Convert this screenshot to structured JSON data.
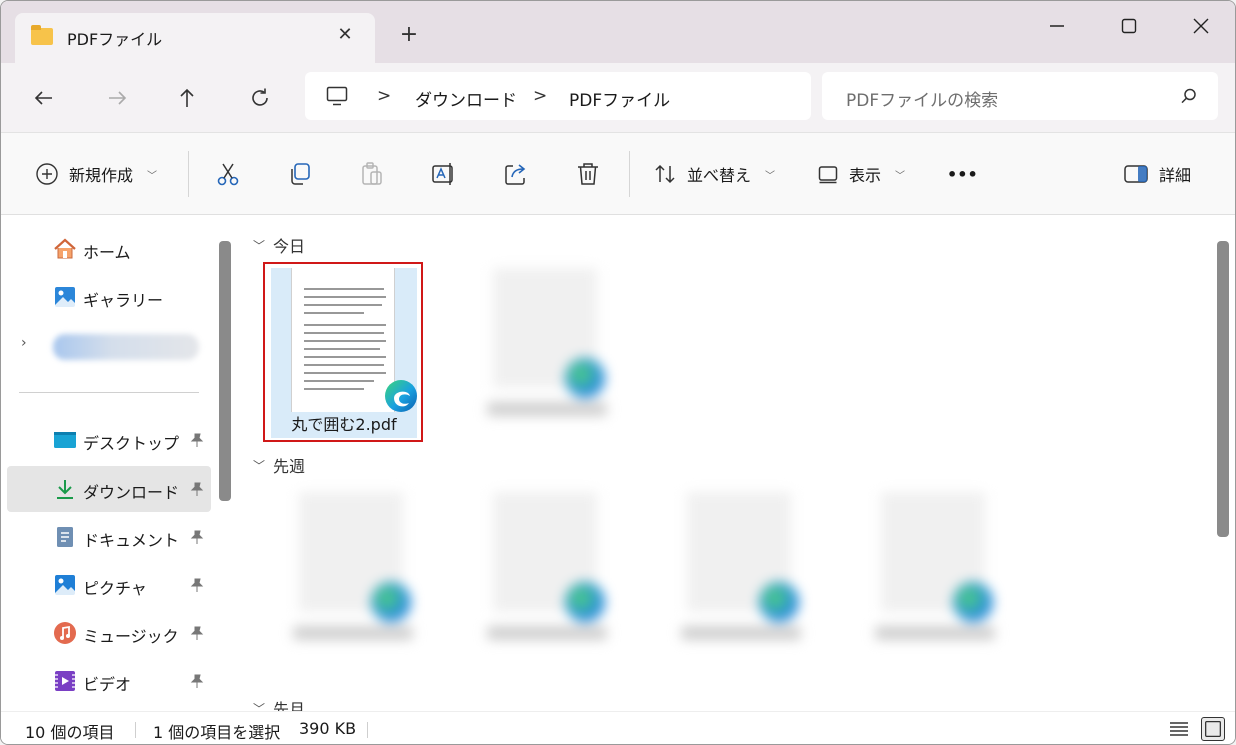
{
  "window": {
    "tab_title": "PDFファイル",
    "new_tab_symbol": "+"
  },
  "address": {
    "crumbs": [
      "ダウンロード",
      "PDFファイル"
    ],
    "separator": ">"
  },
  "search": {
    "placeholder": "PDFファイルの検索"
  },
  "toolbar": {
    "new_label": "新規作成",
    "sort_label": "並べ替え",
    "view_label": "表示",
    "more_label": "•••",
    "details_label": "詳細"
  },
  "sidebar": {
    "items": [
      {
        "label": "ホーム",
        "icon": "home-icon",
        "pinned": false
      },
      {
        "label": "ギャラリー",
        "icon": "gallery-icon",
        "pinned": false
      },
      {
        "label": "デスクトップ",
        "icon": "desktop-icon",
        "pinned": true
      },
      {
        "label": "ダウンロード",
        "icon": "download-icon",
        "pinned": true,
        "selected": true
      },
      {
        "label": "ドキュメント",
        "icon": "document-icon",
        "pinned": true
      },
      {
        "label": "ピクチャ",
        "icon": "pictures-icon",
        "pinned": true
      },
      {
        "label": "ミュージック",
        "icon": "music-icon",
        "pinned": true
      },
      {
        "label": "ビデオ",
        "icon": "video-icon",
        "pinned": true
      }
    ]
  },
  "content": {
    "groups": [
      {
        "label": "今日"
      },
      {
        "label": "先週"
      },
      {
        "label": "先月"
      }
    ],
    "selected_file": {
      "name": "丸で囲む2.pdf",
      "icon": "edge-pdf-icon"
    }
  },
  "status": {
    "item_count": "10 個の項目",
    "selection": "1 個の項目を選択",
    "size": "390 KB"
  },
  "colors": {
    "selection_highlight": "#d9ebf9",
    "selection_border": "#d01818",
    "folder": "#f7c34a"
  }
}
